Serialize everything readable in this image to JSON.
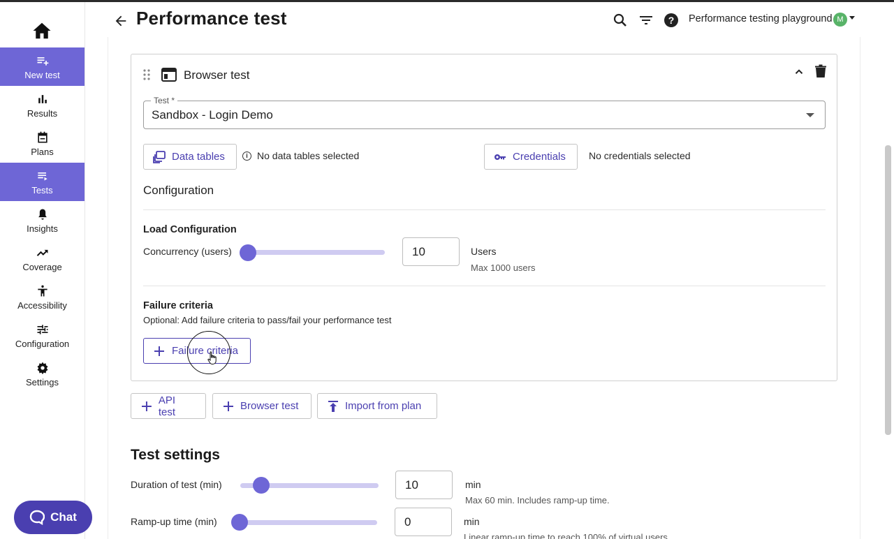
{
  "sidebar": {
    "items": [
      {
        "label": "New test",
        "icon": "playlist-add-icon"
      },
      {
        "label": "Results",
        "icon": "bar-chart-icon"
      },
      {
        "label": "Plans",
        "icon": "calendar-icon"
      },
      {
        "label": "Tests",
        "icon": "list-icon"
      },
      {
        "label": "Insights",
        "icon": "bell-icon"
      },
      {
        "label": "Coverage",
        "icon": "trending-up-icon"
      },
      {
        "label": "Accessibility",
        "icon": "accessibility-icon"
      },
      {
        "label": "Configuration",
        "icon": "tune-icon"
      },
      {
        "label": "Settings",
        "icon": "gear-icon"
      }
    ],
    "active_color": "#6e66d6"
  },
  "header": {
    "title": "Performance test",
    "workspace": "Performance testing playground",
    "avatar_initial": "M"
  },
  "browser_test": {
    "title": "Browser test",
    "test_label": "Test *",
    "test_value": "Sandbox - Login Demo",
    "data_tables_label": "Data tables",
    "data_tables_status": "No data tables selected",
    "credentials_label": "Credentials",
    "credentials_status": "No credentials selected",
    "configuration_heading": "Configuration",
    "load_heading": "Load Configuration",
    "concurrency_label": "Concurrency (users)",
    "concurrency_value": "10",
    "concurrency_unit": "Users",
    "concurrency_max": "Max 1000 users",
    "concurrency_fraction": 0.01,
    "failure_heading": "Failure criteria",
    "failure_desc": "Optional: Add failure criteria to pass/fail your performance test",
    "failure_button": "Failure criteria"
  },
  "add_buttons": {
    "api": "API test",
    "browser": "Browser test",
    "import": "Import from plan"
  },
  "test_settings": {
    "title": "Test settings",
    "duration_label": "Duration of test (min)",
    "duration_value": "10",
    "duration_unit": "min",
    "duration_note": "Max 60 min. Includes ramp-up time.",
    "duration_fraction": 0.167,
    "rampup_label": "Ramp-up time (min)",
    "rampup_value": "0",
    "rampup_unit": "min",
    "rampup_note": "Linear ramp-up time to reach 100% of virtual users.",
    "rampup_fraction": 0
  },
  "chat": {
    "label": "Chat"
  },
  "colors": {
    "accent": "#4a3fb0",
    "accent_light": "#6e66d6",
    "track": "#cfcbf1"
  }
}
